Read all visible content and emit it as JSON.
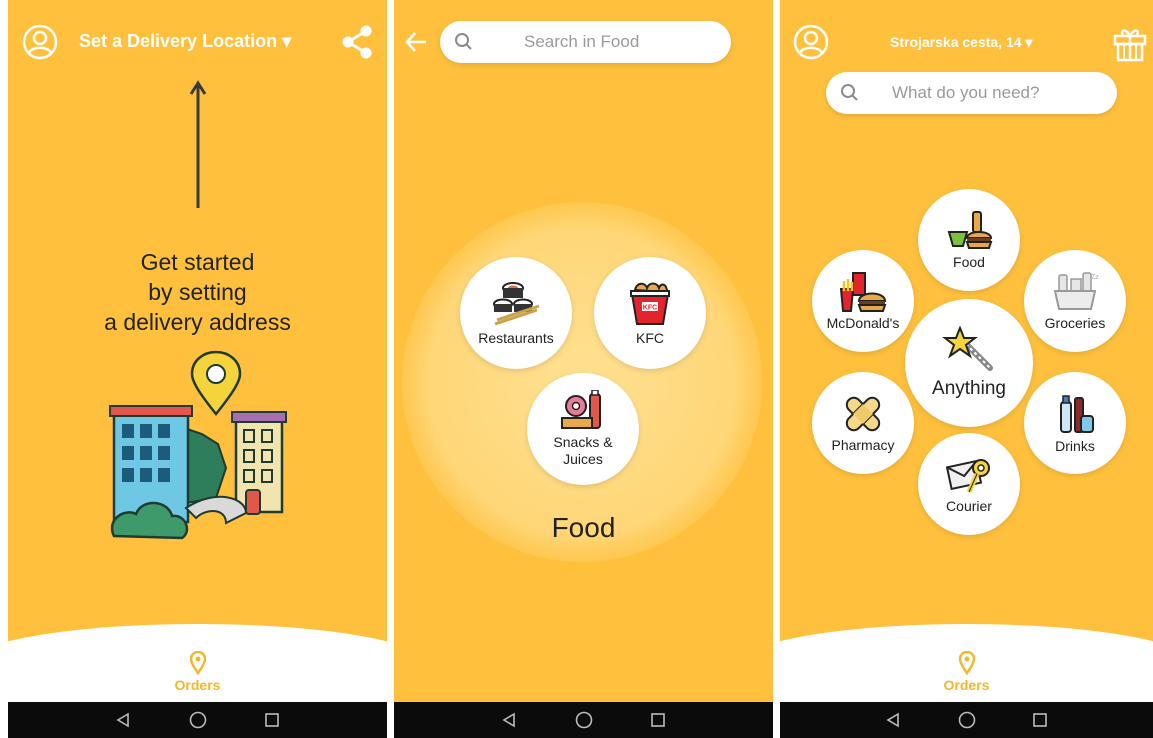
{
  "screen1": {
    "header_title": "Set a Delivery Location ▾",
    "message_line1": "Get started",
    "message_line2": "by setting",
    "message_line3": "a delivery address",
    "orders_label": "Orders"
  },
  "screen2": {
    "search_placeholder": "Search in Food",
    "categories": [
      {
        "label": "Restaurants"
      },
      {
        "label": "KFC"
      },
      {
        "label_line1": "Snacks &",
        "label_line2": "Juices"
      }
    ],
    "section_title": "Food"
  },
  "screen3": {
    "header_title": "Strojarska cesta, 14 ▾",
    "search_placeholder": "What do you need?",
    "categories": {
      "food": "Food",
      "mcdonalds": "McDonald's",
      "groceries": "Groceries",
      "anything": "Anything",
      "pharmacy": "Pharmacy",
      "drinks": "Drinks",
      "courier": "Courier"
    },
    "orders_label": "Orders"
  },
  "colors": {
    "background": "#FFC13D",
    "accent": "#F4B62A",
    "navbar": "#0b0b0b"
  },
  "icons": {
    "profile": "user-circle-icon",
    "share": "share-icon",
    "back": "back-arrow-icon",
    "search": "search-icon",
    "gift": "gift-icon",
    "location_pin": "location-pin-icon"
  }
}
